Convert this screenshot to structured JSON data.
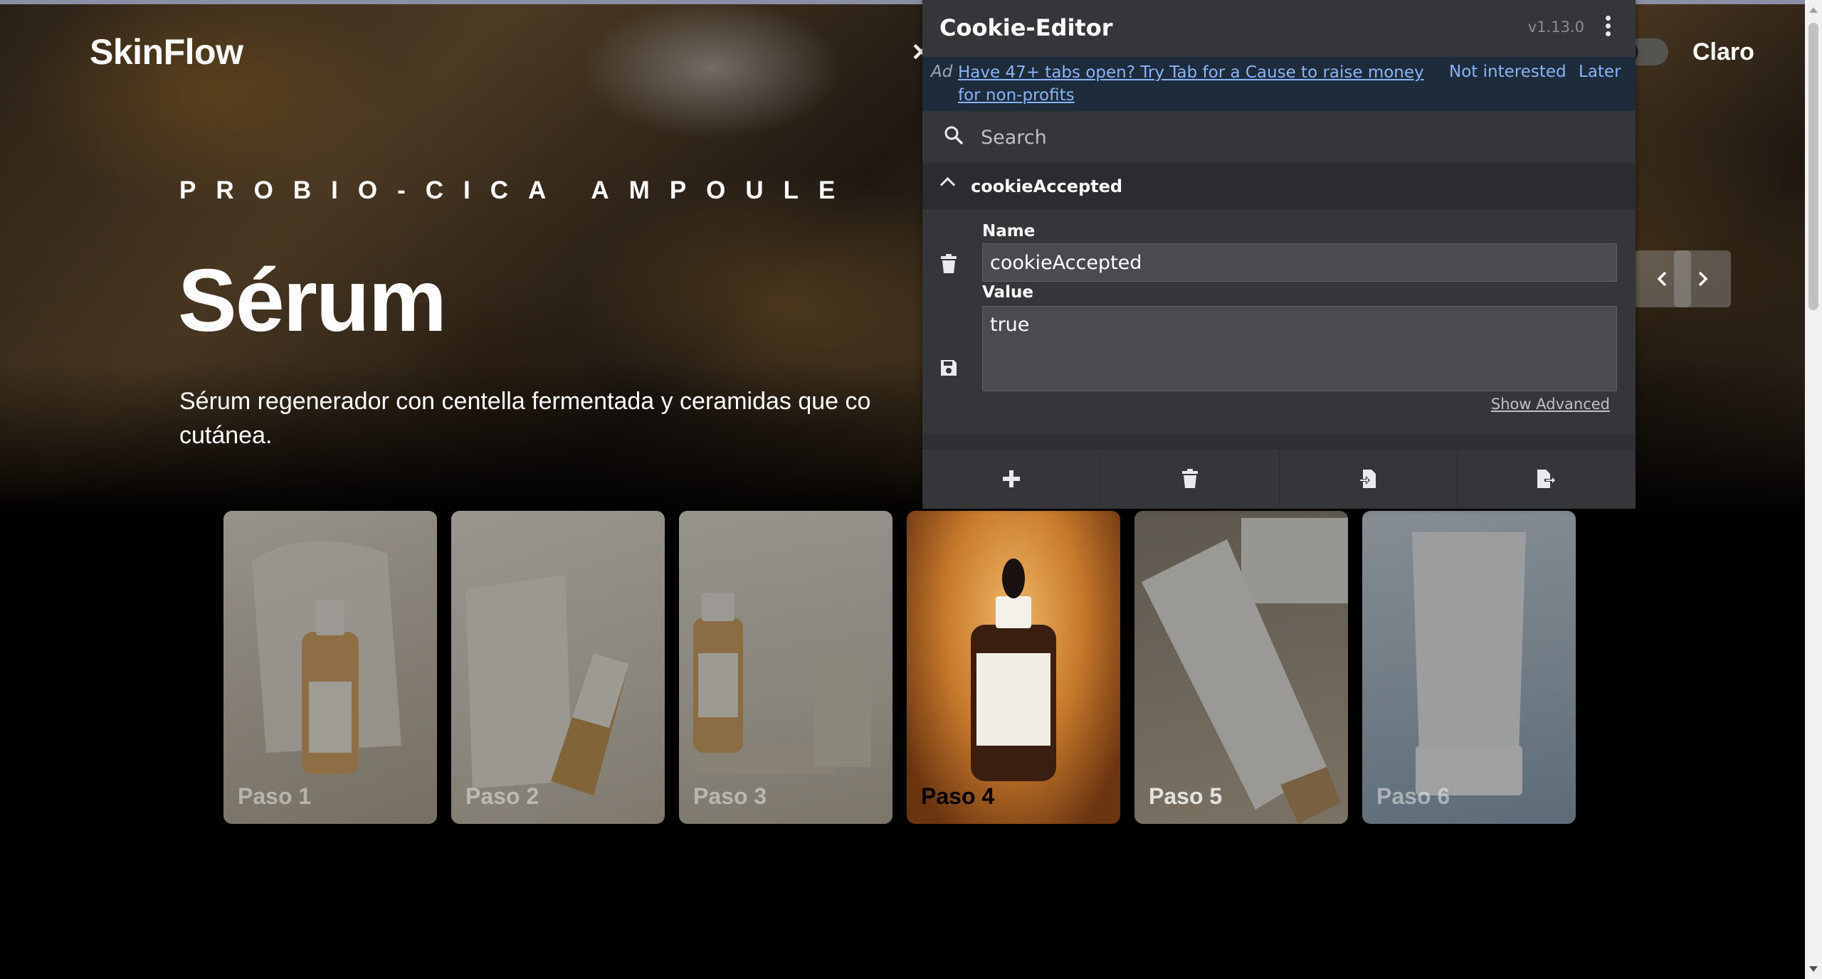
{
  "site": {
    "logo": "SkinFlow",
    "theme_label": "Claro",
    "eyebrow": "PROBIO-CICA AMPOULE",
    "title": "Sérum",
    "description": "Sérum regenerador con centella fermentada y ceramidas que co cutánea.",
    "cards": [
      {
        "label": "Paso 1"
      },
      {
        "label": "Paso 2"
      },
      {
        "label": "Paso 3"
      },
      {
        "label": "Paso 4"
      },
      {
        "label": "Paso 5"
      },
      {
        "label": "Paso 6"
      }
    ],
    "active_card": "Paso 4",
    "nav_prev_icon": "chevron-left-icon",
    "nav_next_icon": "chevron-right-icon"
  },
  "cookie_editor": {
    "title": "Cookie-Editor",
    "version": "v1.13.0",
    "ad": {
      "tag": "Ad",
      "text": "Have 47+ tabs open? Try Tab for a Cause to raise money for non-profits",
      "not_interested": "Not interested",
      "later": "Later"
    },
    "search_placeholder": "Search",
    "cookie": {
      "header_name": "cookieAccepted",
      "name_label": "Name",
      "name_value": "cookieAccepted",
      "value_label": "Value",
      "value_value": "true",
      "show_advanced": "Show Advanced"
    },
    "footer_icons": [
      "plus-icon",
      "trash-icon",
      "import-icon",
      "export-icon"
    ],
    "colors": {
      "panel_bg": "#35363a",
      "ad_bg": "#1e2b3a",
      "link": "#8ab4f8"
    }
  }
}
